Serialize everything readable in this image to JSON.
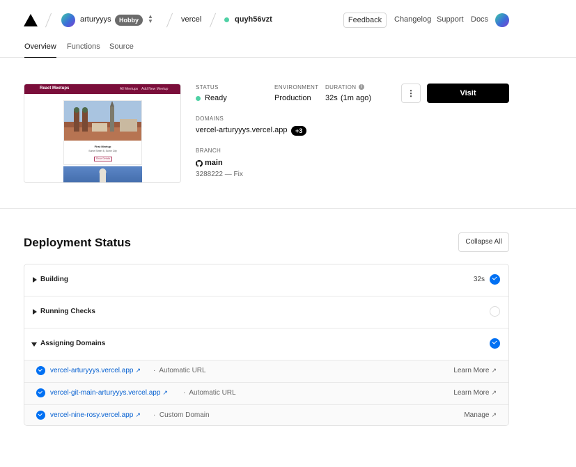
{
  "header": {
    "user": "arturyyys",
    "plan_badge": "Hobby",
    "project": "vercel",
    "deployment": "quyh56vzt",
    "feedback_label": "Feedback",
    "links": [
      "Changelog",
      "Support",
      "Docs"
    ]
  },
  "tabs": [
    {
      "label": "Overview",
      "active": true
    },
    {
      "label": "Functions",
      "active": false
    },
    {
      "label": "Source",
      "active": false
    }
  ],
  "preview": {
    "site_title": "React Meetups",
    "nav": [
      "All Meetups",
      "Add New Meetup"
    ],
    "card_title": "First Meetup",
    "card_address": "Some Street 5, Some City",
    "card_button": "Show Details"
  },
  "summary": {
    "status_label": "STATUS",
    "status_value": "Ready",
    "environment_label": "ENVIRONMENT",
    "environment_value": "Production",
    "duration_label": "DURATION",
    "duration_value": "32s",
    "duration_ago": "(1m ago)",
    "domains_label": "DOMAINS",
    "domain_value": "vercel-arturyyys.vercel.app",
    "domain_extra": "+3",
    "branch_label": "BRANCH",
    "branch_value": "main",
    "commit": "3288222 — Fix",
    "visit_label": "Visit",
    "menu_glyph": "⋮"
  },
  "deployment_status": {
    "title": "Deployment Status",
    "collapse_label": "Collapse All",
    "steps": [
      {
        "label": "Building",
        "time": "32s",
        "state": "done",
        "expanded": false
      },
      {
        "label": "Running Checks",
        "time": "",
        "state": "pending",
        "expanded": false
      },
      {
        "label": "Assigning Domains",
        "time": "",
        "state": "done",
        "expanded": true
      }
    ],
    "domains": [
      {
        "url": "vercel-arturyyys.vercel.app",
        "type": "Automatic URL",
        "action": "Learn More"
      },
      {
        "url": "vercel-git-main-arturyyys.vercel.app",
        "type": "Automatic URL",
        "action": "Learn More"
      },
      {
        "url": "vercel-nine-rosy.vercel.app",
        "type": "Custom Domain",
        "action": "Manage"
      }
    ]
  },
  "colors": {
    "accent_blue": "#0070f3",
    "ready_green": "#4fd1a5",
    "preview_brand": "#7a0e3a"
  },
  "icons": [
    "vercel-logo-icon",
    "avatar",
    "chevron-updown-icon",
    "github-icon",
    "info-icon",
    "external-link-icon",
    "check-circle-icon"
  ]
}
